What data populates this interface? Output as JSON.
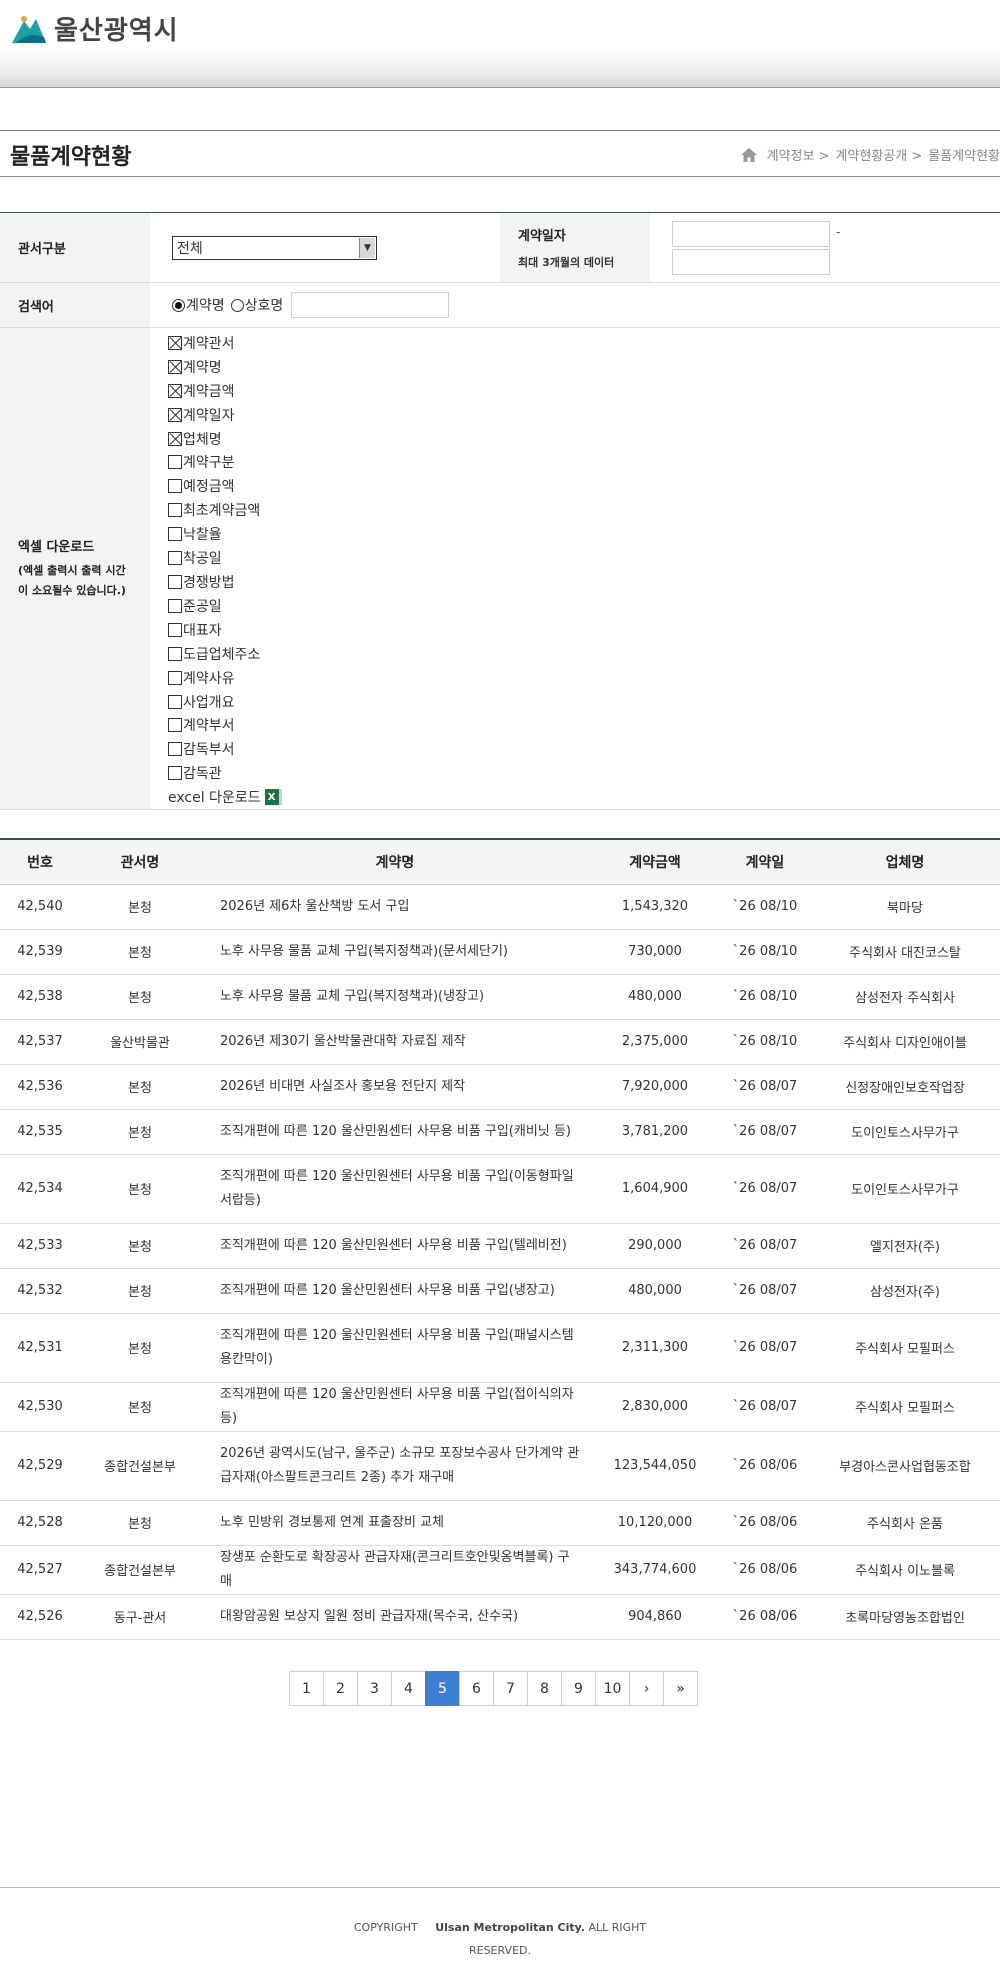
{
  "header": {
    "logo_text": "울산광역시"
  },
  "page": {
    "title": "물품계약현황",
    "breadcrumb": [
      "계약정보 >",
      "계약현황공개 >",
      "물품계약현황"
    ]
  },
  "form": {
    "dept_label": "관서구분",
    "dept_value": "전체",
    "date_label": "계약일자",
    "date_note": "최대 3개월의 데이터",
    "date_dash": "-",
    "search_label": "검색어",
    "radio_options": [
      "계약명",
      "상호명"
    ],
    "excel_label": "엑셀 다운로드",
    "excel_note": "(엑셀 출력시 출력 시간이 소요될수 있습니다.)",
    "checkboxes": [
      {
        "label": "계약관서",
        "checked": true
      },
      {
        "label": "계약명",
        "checked": true
      },
      {
        "label": "계약금액",
        "checked": true
      },
      {
        "label": "계약일자",
        "checked": true
      },
      {
        "label": "업체명",
        "checked": true
      },
      {
        "label": "계약구분",
        "checked": false
      },
      {
        "label": "예정금액",
        "checked": false
      },
      {
        "label": "최초계약금액",
        "checked": false
      },
      {
        "label": "낙찰율",
        "checked": false
      },
      {
        "label": "착공일",
        "checked": false
      },
      {
        "label": "경쟁방법",
        "checked": false
      },
      {
        "label": "준공일",
        "checked": false
      },
      {
        "label": "대표자",
        "checked": false
      },
      {
        "label": "도급업체주소",
        "checked": false
      },
      {
        "label": "계약사유",
        "checked": false
      },
      {
        "label": "사업개요",
        "checked": false
      },
      {
        "label": "계약부서",
        "checked": false
      },
      {
        "label": "감독부서",
        "checked": false
      },
      {
        "label": "감독관",
        "checked": false
      }
    ],
    "excel_download": "excel 다운로드",
    "excel_icon": "X"
  },
  "table": {
    "columns": [
      "번호",
      "관서명",
      "계약명",
      "계약금액",
      "계약일",
      "업체명"
    ],
    "rows": [
      [
        "42,540",
        "본청",
        "2026년 제6차 울산책방 도서 구입",
        "1,543,320",
        "`26 08/10",
        "북마당"
      ],
      [
        "42,539",
        "본청",
        "노후 사무용 물품 교체 구입(복지정책과)(문서세단기)",
        "730,000",
        "`26 08/10",
        "주식회사 대진코스탈"
      ],
      [
        "42,538",
        "본청",
        "노후 사무용 물품 교체 구입(복지정책과)(냉장고)",
        "480,000",
        "`26 08/10",
        "삼성전자 주식회사"
      ],
      [
        "42,537",
        "울산박물관",
        "2026년 제30기 울산박물관대학 자료집 제작",
        "2,375,000",
        "`26 08/10",
        "주식회사 디자인애이블"
      ],
      [
        "42,536",
        "본청",
        "2026년 비대면 사실조사 홍보용 전단지 제작",
        "7,920,000",
        "`26 08/07",
        "신정장애인보호작업장"
      ],
      [
        "42,535",
        "본청",
        "조직개편에 따른 120 울산민원센터 사무용 비품 구입(캐비닛 등)",
        "3,781,200",
        "`26 08/07",
        "도이인토스사무가구"
      ],
      [
        "42,534",
        "본청",
        "조직개편에 따른 120 울산민원센터 사무용 비품 구입(이동형파일서랍등)",
        "1,604,900",
        "`26 08/07",
        "도이인토스사무가구"
      ],
      [
        "42,533",
        "본청",
        "조직개편에 따른 120 울산민원센터 사무용 비품 구입(텔레비전)",
        "290,000",
        "`26 08/07",
        "엘지전자(주)"
      ],
      [
        "42,532",
        "본청",
        "조직개편에 따른 120 울산민원센터 사무용 비품 구입(냉장고)",
        "480,000",
        "`26 08/07",
        "삼성전자(주)"
      ],
      [
        "42,531",
        "본청",
        "조직개편에 따른 120 울산민원센터 사무용 비품 구입(패널시스템용칸막이)",
        "2,311,300",
        "`26 08/07",
        "주식회사 모필퍼스"
      ],
      [
        "42,530",
        "본청",
        "조직개편에 따른 120 울산민원센터 사무용 비품 구입(접이식의자 등)",
        "2,830,000",
        "`26 08/07",
        "주식회사 모필퍼스"
      ],
      [
        "42,529",
        "종합건설본부",
        "2026년 광역시도(남구, 울주군) 소규모 포장보수공사 단가계약 관급자재(아스팔트콘크리트 2종) 추가 재구매",
        "123,544,050",
        "`26 08/06",
        "부경아스콘사업협동조합"
      ],
      [
        "42,528",
        "본청",
        "노후 민방위 경보통제 연계 표출장비 교체",
        "10,120,000",
        "`26 08/06",
        "주식회사 온품"
      ],
      [
        "42,527",
        "종합건설본부",
        "장생포 순환도로 확장공사 관급자재(콘크리트호안및옹벽블록) 구매",
        "343,774,600",
        "`26 08/06",
        "주식회사 이노블록"
      ],
      [
        "42,526",
        "동구-관서",
        "대왕암공원 보상지 일원 정비 관급자재(목수국, 산수국)",
        "904,860",
        "`26 08/06",
        "초록마당영농조합법인"
      ]
    ]
  },
  "pagination": {
    "pages": [
      "1",
      "2",
      "3",
      "4",
      "5",
      "6",
      "7",
      "8",
      "9",
      "10"
    ],
    "current": "5",
    "next": "›",
    "last": "»"
  },
  "footer": {
    "prefix": "COPYRIGHT",
    "org": "Ulsan Metropolitan City.",
    "suffix": "ALL RIGHT RESERVED."
  }
}
